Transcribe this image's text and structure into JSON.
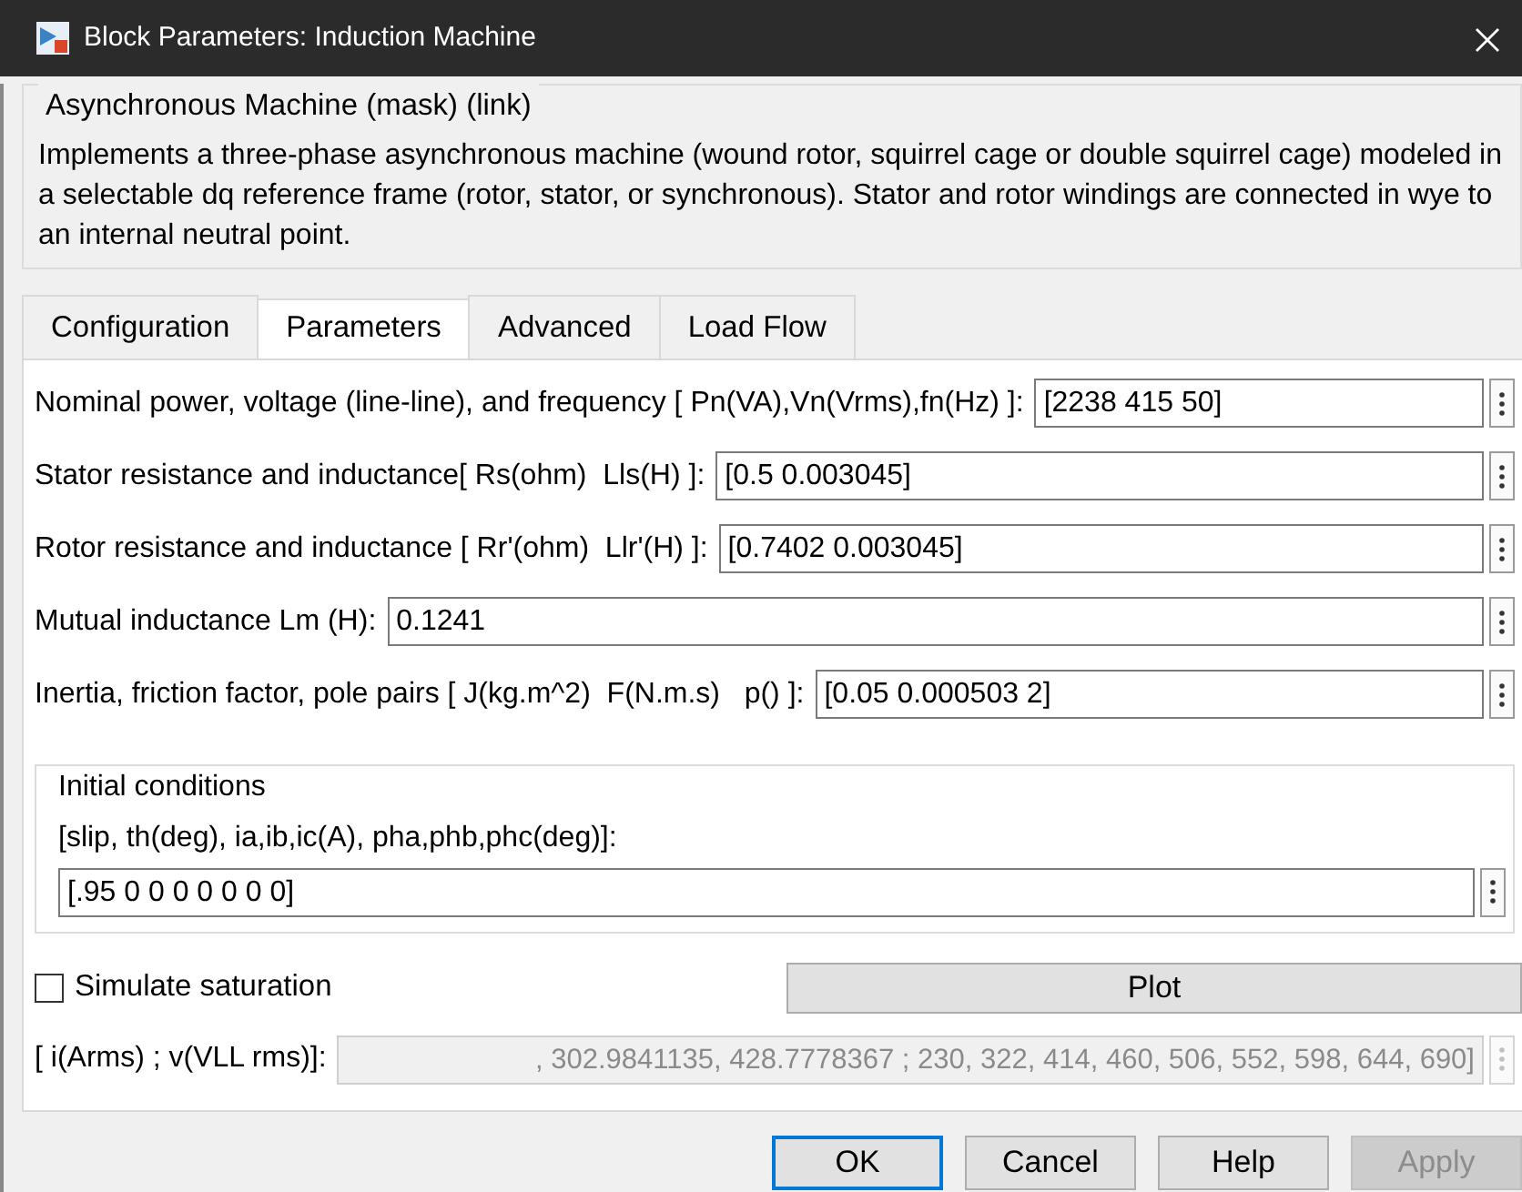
{
  "window": {
    "title": "Block Parameters: Induction Machine"
  },
  "mask": {
    "title": "Asynchronous Machine (mask) (link)",
    "description": "Implements a three-phase asynchronous machine (wound rotor, squirrel cage or double squirrel cage) modeled in a selectable dq reference frame (rotor, stator, or synchronous). Stator and rotor windings are connected in wye to an internal neutral point."
  },
  "tabs": [
    {
      "label": "Configuration",
      "selected": false
    },
    {
      "label": "Parameters",
      "selected": true
    },
    {
      "label": "Advanced",
      "selected": false
    },
    {
      "label": "Load Flow",
      "selected": false
    }
  ],
  "parameters": [
    {
      "label": "Nominal power, voltage (line-line), and frequency [ Pn(VA),Vn(Vrms),fn(Hz) ]:",
      "value": "[2238 415 50]"
    },
    {
      "label": "Stator resistance and inductance[ Rs(ohm)  Lls(H) ]:",
      "value": "[0.5 0.003045]"
    },
    {
      "label": "Rotor resistance and inductance [ Rr'(ohm)  Llr'(H) ]:",
      "value": "[0.7402 0.003045]"
    },
    {
      "label": "Mutual inductance Lm (H):",
      "value": "0.1241"
    },
    {
      "label": "Inertia, friction factor, pole pairs [ J(kg.m^2)  F(N.m.s)   p() ]:",
      "value": "[0.05 0.000503 2]"
    }
  ],
  "initial_conditions": {
    "title": "Initial conditions",
    "label": "[slip, th(deg), ia,ib,ic(A), pha,phb,phc(deg)]:",
    "value": "[.95 0 0 0 0 0 0 0]"
  },
  "simulate_saturation": {
    "label": "Simulate saturation",
    "checked": false
  },
  "plot_button": {
    "label": "Plot"
  },
  "saturation_data": {
    "label": "[ i(Arms) ; v(VLL rms)]:",
    "value": ", 302.9841135, 428.7778367 ; 230, 322, 414, 460, 506, 552, 598, 644, 690]",
    "disabled": true
  },
  "buttons": [
    {
      "label": "OK",
      "default": true,
      "disabled": false
    },
    {
      "label": "Cancel",
      "default": false,
      "disabled": false
    },
    {
      "label": "Help",
      "default": false,
      "disabled": false
    },
    {
      "label": "Apply",
      "default": false,
      "disabled": true
    }
  ]
}
